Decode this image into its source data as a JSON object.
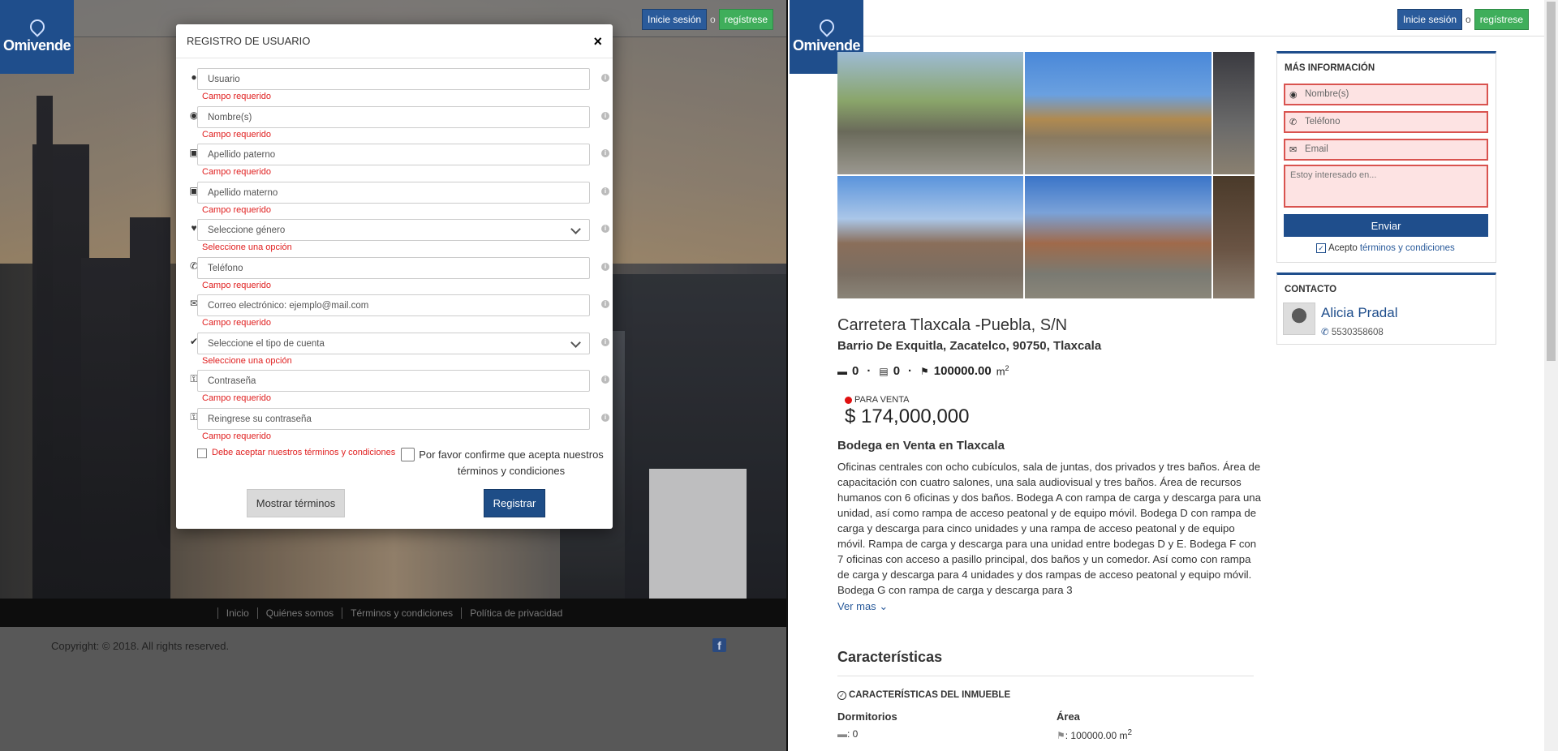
{
  "brand": {
    "name": "Omivende"
  },
  "auth": {
    "login_label": "Inicie sesión",
    "or_label": "o",
    "register_label": "regístrese"
  },
  "modal": {
    "title": "REGISTRO DE USUARIO",
    "close": "×",
    "fields": [
      {
        "icon": "user-icon",
        "placeholder": "Usuario",
        "error": "Campo requerido",
        "type": "text"
      },
      {
        "icon": "user-circle-icon",
        "placeholder": "Nombre(s)",
        "error": "Campo requerido",
        "type": "text"
      },
      {
        "icon": "id-card-icon",
        "placeholder": "Apellido paterno",
        "error": "Campo requerido",
        "type": "text"
      },
      {
        "icon": "id-card-icon",
        "placeholder": "Apellido materno",
        "error": "Campo requerido",
        "type": "text"
      },
      {
        "icon": "heart-icon",
        "placeholder": "Seleccione género",
        "error": "Seleccione una opción",
        "type": "select"
      },
      {
        "icon": "phone-icon",
        "placeholder": "Teléfono",
        "error": "Campo requerido",
        "type": "text"
      },
      {
        "icon": "envelope-icon",
        "placeholder": "Correo electrónico: ejemplo@mail.com",
        "error": "Campo requerido",
        "type": "text"
      },
      {
        "icon": "check-circle-icon",
        "placeholder": "Seleccione el tipo de cuenta",
        "error": "Seleccione una opción",
        "type": "select"
      },
      {
        "icon": "lock-icon",
        "placeholder": "Contraseña",
        "error": "Campo requerido",
        "type": "password"
      },
      {
        "icon": "lock-icon",
        "placeholder": "Reingrese su contraseña",
        "error": "Campo requerido",
        "type": "password"
      }
    ],
    "terms_error": "Debe aceptar nuestros términos y condiciones",
    "confirm_text": "Por favor confirme que acepta nuestros términos y condiciones",
    "show_terms_label": "Mostrar términos",
    "submit_label": "Registrar"
  },
  "footer": {
    "links": [
      "Inicio",
      "Quiénes somos",
      "Términos y condiciones",
      "Política de privacidad"
    ],
    "copyright": "Copyright: © 2018. All rights reserved.",
    "social_icon": "facebook-icon"
  },
  "property": {
    "title": "Carretera Tlaxcala -Puebla, S/N",
    "address": "Barrio De Exquitla, Zacatelco, 90750, Tlaxcala",
    "bedrooms": "0",
    "bathrooms": "0",
    "area": "100000.00",
    "area_unit": "m",
    "area_unit_sup": "2",
    "status": "PARA VENTA",
    "price": "$ 174,000,000",
    "subtitle": "Bodega en Venta en Tlaxcala",
    "description": "Oficinas centrales con ocho cubículos, sala de juntas, dos privados y tres baños. Área de capacitación con cuatro salones, una sala audiovisual y tres baños. Área de recursos humanos con 6 oficinas y dos baños. Bodega A con rampa de carga y descarga para una unidad, así como rampa de acceso peatonal y de equipo móvil. Bodega D con rampa de carga y descarga para cinco unidades y una rampa de acceso peatonal y de equipo móvil. Rampa de carga y descarga para una unidad entre bodegas D y E. Bodega F con 7 oficinas con acceso a pasillo principal, dos baños y un comedor. Así como con rampa de carga y descarga para 4 unidades y dos rampas de acceso peatonal y equipo móvil. Bodega G con rampa de carga y descarga para 3",
    "see_more": "Ver mas",
    "features_title": "Características",
    "features_header": "CARACTERÍSTICAS DEL INMUEBLE",
    "features": [
      {
        "label": "Dormitorios",
        "value": ": 0"
      },
      {
        "label": "Área",
        "value": ": 100000.00 m",
        "sup": "2"
      }
    ]
  },
  "info_card": {
    "title": "MÁS INFORMACIÓN",
    "name_placeholder": "Nombre(s)",
    "phone_placeholder": "Teléfono",
    "email_placeholder": "Email",
    "message_placeholder": "Estoy interesado en...",
    "send_label": "Enviar",
    "accept_label": "Acepto",
    "terms_link": "términos y condiciones"
  },
  "contact_card": {
    "title": "CONTACTO",
    "agent_name": "Alicia Pradal",
    "agent_phone": "5530358608"
  },
  "colors": {
    "primary": "#1f4e8c",
    "success": "#3fae5b",
    "error": "#e02020"
  }
}
